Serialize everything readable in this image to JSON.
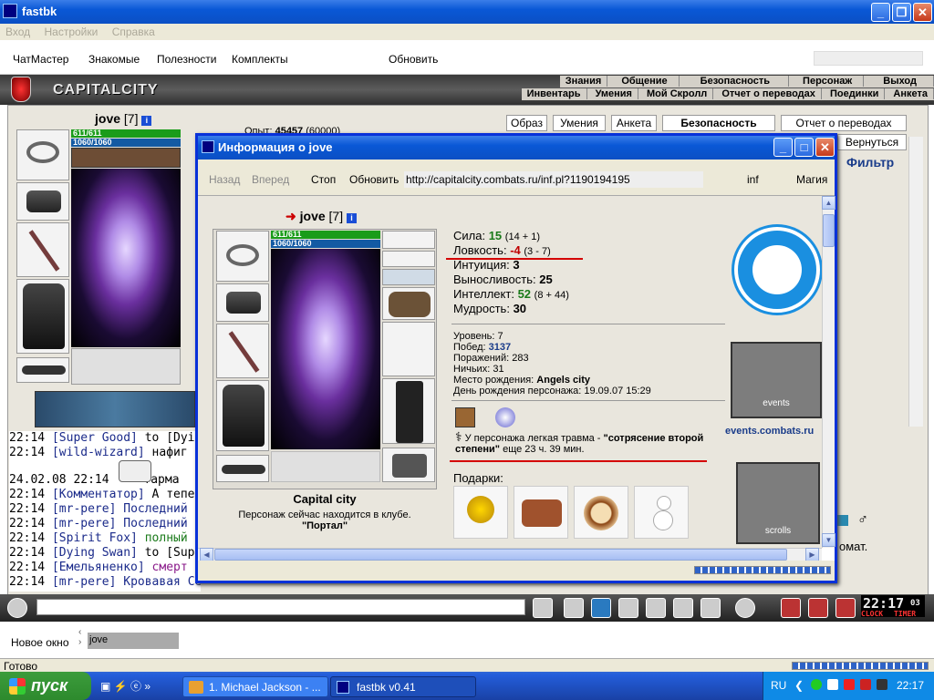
{
  "app": {
    "title": "fastbk",
    "menu": [
      "Вход",
      "Настройки",
      "Справка"
    ],
    "toolbar": [
      "ЧатМастер",
      "Знакомые",
      "Полезности",
      "Комплекты",
      "Обновить"
    ],
    "logo": "CAPITALCITY"
  },
  "game_nav": {
    "row1": [
      "Знания",
      "Общение",
      "Безопасность",
      "Персонаж",
      "Выход"
    ],
    "row2": [
      "Инвентарь",
      "Умения",
      "Мой Скролл",
      "Отчет о переводах",
      "Поединки",
      "Анкета"
    ]
  },
  "player": {
    "name": "jove",
    "level": "[7]",
    "hp": "611/611",
    "mana": "1060/1060",
    "exp_label": "Опыт:",
    "exp_value": "45457",
    "exp_next": "(60000)"
  },
  "tabs": [
    "Образ",
    "Умения",
    "Анкета",
    "Безопасность",
    "Отчет о переводах",
    "Вернуться",
    "Фильтр"
  ],
  "chat": [
    {
      "time": "22:14",
      "name": "[Super Good]",
      "text": " to [Dying"
    },
    {
      "time": "22:14",
      "name": "[wild-wizard]",
      "text": " нафиг э"
    },
    {
      "time": "24.02.08 22:14",
      "name": "",
      "text": "Тарма"
    },
    {
      "time": "22:14",
      "name": "[Комментатор]",
      "text": " А тепе"
    },
    {
      "time": "22:14",
      "name": "[mr-pere]",
      "text": " Последний"
    },
    {
      "time": "22:14",
      "name": "[mr-pere]",
      "text": " Последний"
    },
    {
      "time": "22:14",
      "name": "[Spirit Fox]",
      "text": " полный ви"
    },
    {
      "time": "22:14",
      "name": "[Dying Swan]",
      "text": " to [Supe"
    },
    {
      "time": "22:14",
      "name": "[Емельяненко]",
      "text": " смерт"
    },
    {
      "time": "22:14",
      "name": "[mr-pere]",
      "text": " Кровавая Сеча."
    }
  ],
  "right_fragment": "омат.",
  "dialog": {
    "title": "Информация о jove",
    "nav": [
      "Назад",
      "Вперед",
      "Стоп",
      "Обновить"
    ],
    "url": "http://capitalcity.combats.ru/inf.pl?1190194195",
    "extra": [
      "inf",
      "Магия"
    ],
    "char_name": "jove",
    "char_level": "[7]",
    "hp": "611/611",
    "mana": "1060/1060",
    "city": "Capital city",
    "location_line1": "Персонаж сейчас находится в клубе.",
    "location_line2": "\"Портал\"",
    "stats": [
      {
        "label": "Сила:",
        "value": "15",
        "extra": "(14 + 1)",
        "color": "#1a7a1a"
      },
      {
        "label": "Ловкость:",
        "value": "-4",
        "extra": "(3 - 7)",
        "color": "#c00000"
      },
      {
        "label": "Интуиция:",
        "value": "3",
        "extra": "",
        "color": "#000000"
      },
      {
        "label": "Выносливость:",
        "value": "25",
        "extra": "",
        "color": "#000000"
      },
      {
        "label": "Интеллект:",
        "value": "52",
        "extra": "(8 + 44)",
        "color": "#1a7a1a"
      },
      {
        "label": "Мудрость:",
        "value": "30",
        "extra": "",
        "color": "#000000"
      }
    ],
    "info": [
      {
        "label": "Уровень:",
        "value": "7"
      },
      {
        "label": "Побед:",
        "value": "3137"
      },
      {
        "label": "Поражений:",
        "value": "283"
      },
      {
        "label": "Ничьих:",
        "value": "31"
      },
      {
        "label": "Место рождения:",
        "value": "Angels city"
      },
      {
        "label": "День рождения персонажа:",
        "value": "19.09.07 15:29"
      }
    ],
    "injury_pre": "У персонажа легкая травма - ",
    "injury_bold": "\"сотрясение второй степени\"",
    "injury_post": " еще 23 ч. 39 мин.",
    "gifts_label": "Подарки:",
    "events_link": "events.combats.ru",
    "banner1": "events",
    "banner2": "scrolls"
  },
  "bottom": {
    "clock": "22:17",
    "clock_sec": "03",
    "clock_label": "CLOCK",
    "timer_label": "TIMER",
    "new_window": "Новое окно",
    "search_value": "jove"
  },
  "status": "Готово",
  "taskbar": {
    "start": "пуск",
    "tasks": [
      "1. Michael Jackson - ...",
      "fastbk v0.41"
    ],
    "lang": "RU",
    "time": "22:17"
  }
}
